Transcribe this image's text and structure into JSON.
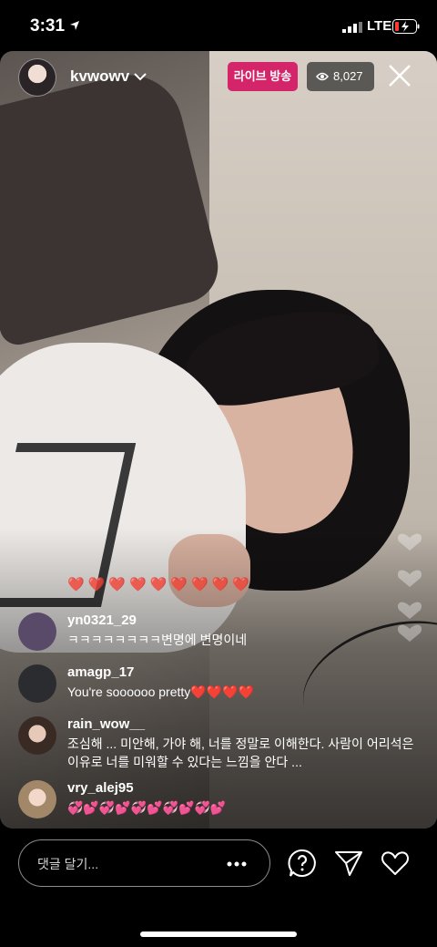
{
  "status_bar": {
    "time": "3:31",
    "network": "LTE"
  },
  "header": {
    "username": "kvwowv",
    "live_label": "라이브 방송",
    "viewer_count": "8,027"
  },
  "hearts_row": "❤️❤️❤️❤️❤️❤️❤️❤️❤️",
  "comments": [
    {
      "user": "yn0321_29",
      "text": "ㅋㅋㅋㅋㅋㅋㅋㅋ변명에 변명이네"
    },
    {
      "user": "amagp_17",
      "text": "You're soooooo pretty❤️❤️❤️❤️"
    },
    {
      "user": "rain_wow__",
      "text": "조심해 ... 미안해, 가야 해, 너를 정말로 이해한다. 사람이 어리석은 이유로 너를 미워할 수 있다는 느낌을 안다 ..."
    },
    {
      "user": "vry_alej95",
      "text": "💞💕💞💕💞💕💞💕💞💕"
    }
  ],
  "composer": {
    "placeholder": "댓글 달기..."
  },
  "colors": {
    "live_badge": "#d5256a",
    "heart": "#e23a4c"
  },
  "icons": [
    "location-arrow-icon",
    "signal-icon",
    "battery-icon",
    "chevron-down-icon",
    "eye-icon",
    "close-icon",
    "more-dots-icon",
    "question-icon",
    "send-icon",
    "heart-icon"
  ]
}
